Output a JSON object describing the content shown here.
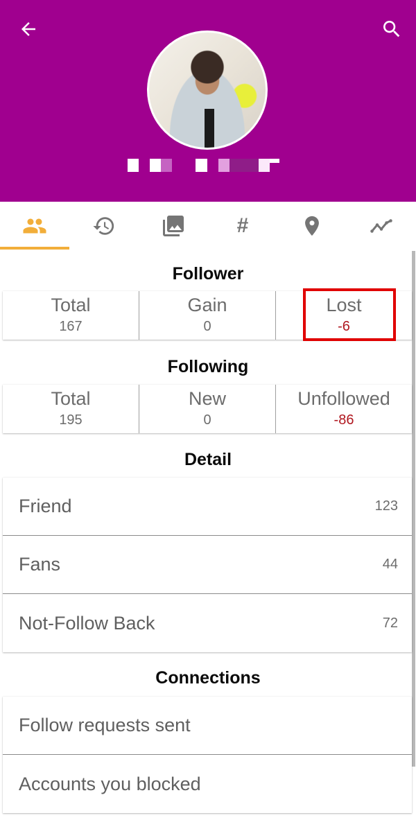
{
  "header": {
    "background_color": "#A0008F",
    "back_icon": "arrow-back-icon",
    "search_icon": "search-icon",
    "username_display": "censored"
  },
  "tabs": [
    {
      "icon": "people-icon",
      "active": true
    },
    {
      "icon": "history-icon",
      "active": false
    },
    {
      "icon": "photo-library-icon",
      "active": false
    },
    {
      "icon": "hashtag-icon",
      "active": false,
      "glyph": "#"
    },
    {
      "icon": "location-pin-icon",
      "active": false
    },
    {
      "icon": "trending-icon",
      "active": false
    }
  ],
  "colors": {
    "accent": "#F2AE3A",
    "icon_gray": "#757575",
    "negative": "#B0171F",
    "highlight": "#E00000"
  },
  "follower": {
    "title": "Follower",
    "stats": [
      {
        "label": "Total",
        "value": "167"
      },
      {
        "label": "Gain",
        "value": "0"
      },
      {
        "label": "Lost",
        "value": "-6"
      }
    ]
  },
  "following": {
    "title": "Following",
    "stats": [
      {
        "label": "Total",
        "value": "195"
      },
      {
        "label": "New",
        "value": "0"
      },
      {
        "label": "Unfollowed",
        "value": "-86"
      }
    ]
  },
  "detail": {
    "title": "Detail",
    "items": [
      {
        "label": "Friend",
        "count": "123"
      },
      {
        "label": "Fans",
        "count": "44"
      },
      {
        "label": "Not-Follow Back",
        "count": "72"
      }
    ]
  },
  "connections": {
    "title": "Connections",
    "items": [
      {
        "label": "Follow requests sent"
      },
      {
        "label": "Accounts you blocked"
      }
    ]
  }
}
